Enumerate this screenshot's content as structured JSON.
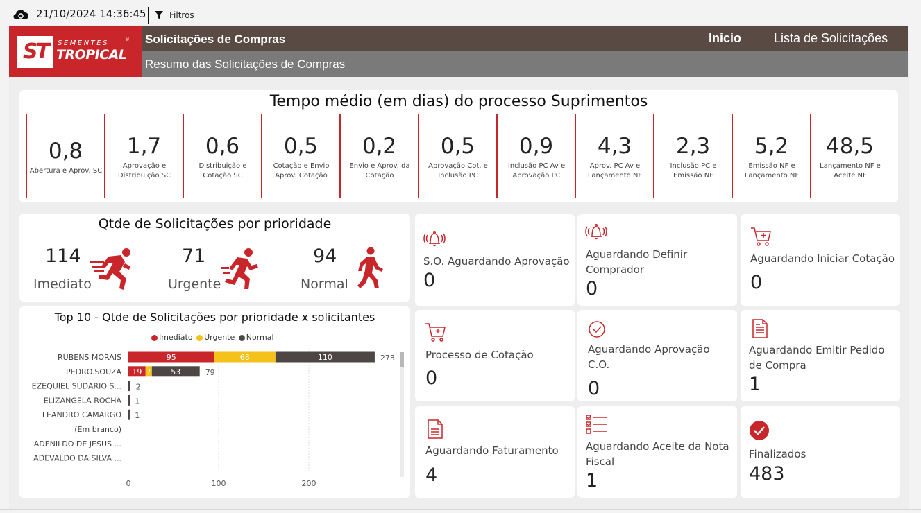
{
  "topbar": {
    "datetime": "21/10/2024 14:36:45",
    "filters_label": "Filtros"
  },
  "header": {
    "logo": {
      "mark": "ST",
      "line1": "SEMENTES",
      "line2": "TROPICAL",
      "reg": "®"
    },
    "title": "Solicitações de Compras",
    "subtitle": "Resumo das Solicitações de Compras",
    "nav": {
      "inicio": "Inicio",
      "lista": "Lista de Solicitações"
    }
  },
  "tempo_medio": {
    "title": "Tempo médio (em dias) do processo Suprimentos",
    "kpis": [
      {
        "value": "0,8",
        "label": "Abertura e Aprov. SC"
      },
      {
        "value": "1,7",
        "label": "Aprovação e Distribuição SC"
      },
      {
        "value": "0,6",
        "label": "Distribuição e Cotação SC"
      },
      {
        "value": "0,5",
        "label": "Cotação e Envio Aprov. Cotação"
      },
      {
        "value": "0,2",
        "label": "Envio e Aprov. da Cotação"
      },
      {
        "value": "0,5",
        "label": "Aprovação Cot. e Inclusão PC"
      },
      {
        "value": "0,9",
        "label": "Inclusão PC Av e Aprovação PC"
      },
      {
        "value": "4,3",
        "label": "Aprov. PC Av e Lançamento NF"
      },
      {
        "value": "2,3",
        "label": "Inclusão PC e Emissão NF"
      },
      {
        "value": "5,2",
        "label": "Emissão NF e Lançamento NF"
      },
      {
        "value": "48,5",
        "label": "Lançamento NF e Aceite NF"
      }
    ]
  },
  "prioridade": {
    "title": "Qtde de Solicitações por prioridade",
    "items": [
      {
        "value": "114",
        "label": "Imediato",
        "icon": "sprinting-person-icon"
      },
      {
        "value": "71",
        "label": "Urgente",
        "icon": "running-person-icon"
      },
      {
        "value": "94",
        "label": "Normal",
        "icon": "walking-person-icon"
      }
    ]
  },
  "chart_data": {
    "type": "bar",
    "orientation": "horizontal",
    "stacked": true,
    "title": "Top 10 - Qtde de Solicitações por prioridade x solicitantes",
    "legend_position": "top",
    "categories": [
      "RUBENS MORAIS",
      "PEDRO.SOUZA",
      "EZEQUIEL SUDARIO S...",
      "ELIZANGELA ROCHA",
      "LEANDRO CAMARGO",
      "(Em branco)",
      "ADENILDO DE JESUS ...",
      "ADEVALDO DA SILVA ..."
    ],
    "series": [
      {
        "name": "Imediato",
        "color": "#c8262a",
        "values": [
          95,
          19,
          0,
          0,
          0,
          0,
          0,
          0
        ]
      },
      {
        "name": "Urgente",
        "color": "#f5c21b",
        "values": [
          68,
          7,
          0,
          0,
          0,
          0,
          0,
          0
        ]
      },
      {
        "name": "Normal",
        "color": "#4d4645",
        "values": [
          110,
          53,
          2,
          1,
          1,
          0,
          0,
          0
        ]
      }
    ],
    "totals": [
      273,
      79,
      2,
      1,
      1,
      null,
      null,
      null
    ],
    "xticks": [
      0,
      100,
      200
    ],
    "xlim": [
      0,
      300
    ],
    "grid": true
  },
  "tiles": [
    {
      "label": "S.O. Aguardando Aprovação",
      "value": "0",
      "icon": "alarm-bell-icon"
    },
    {
      "label": "Aguardando Definir Comprador",
      "value": "0",
      "icon": "alarm-bell-icon"
    },
    {
      "label": "Aguardando Iniciar Cotação",
      "value": "0",
      "icon": "shopping-cart-add-icon"
    },
    {
      "label": "Processo de Cotação",
      "value": "0",
      "icon": "shopping-cart-add-icon"
    },
    {
      "label": "Aguardando Aprovação C.O.",
      "value": "0",
      "icon": "check-circle-icon"
    },
    {
      "label": "Aguardando Emitir Pedido de Compra",
      "value": "1",
      "icon": "document-icon"
    },
    {
      "label": "Aguardando Faturamento",
      "value": "4",
      "icon": "document-icon"
    },
    {
      "label": "Aguardando Aceite da Nota Fiscal",
      "value": "1",
      "icon": "checklist-icon"
    },
    {
      "label": "Finalizados",
      "value": "483",
      "icon": "check-filled-circle-icon"
    }
  ],
  "colors": {
    "brand_red": "#c8262a",
    "header_dark": "#5a4a44",
    "header_gray": "#7a7a7a"
  }
}
